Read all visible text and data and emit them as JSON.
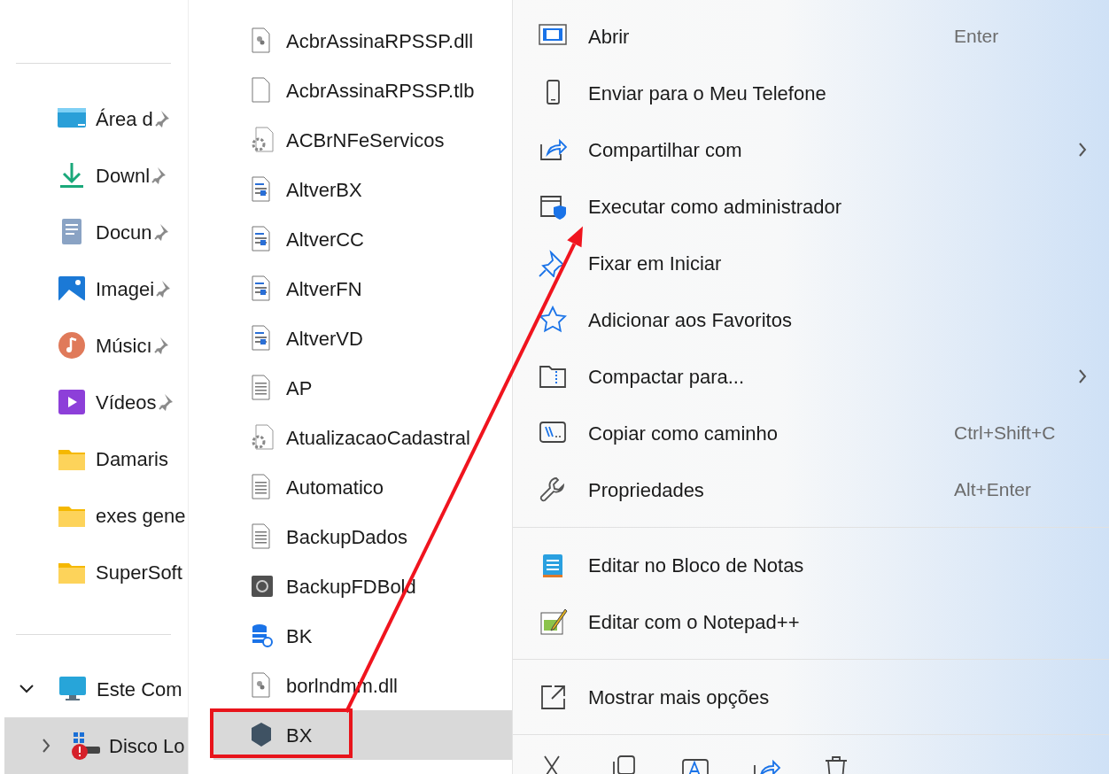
{
  "nav": {
    "quick_access": [
      {
        "label": "Área d",
        "kind": "desktop",
        "pinned": true,
        "selected": false
      },
      {
        "label": "Downl",
        "kind": "download",
        "pinned": true,
        "selected": false
      },
      {
        "label": "Docun",
        "kind": "document",
        "pinned": true,
        "selected": false
      },
      {
        "label": "Imagei",
        "kind": "image",
        "pinned": true,
        "selected": false
      },
      {
        "label": "Músicı",
        "kind": "music",
        "pinned": true,
        "selected": false
      },
      {
        "label": "Vídeos",
        "kind": "video",
        "pinned": true,
        "selected": false
      },
      {
        "label": "Damaris",
        "kind": "folder",
        "pinned": false,
        "selected": false
      },
      {
        "label": "exes gene",
        "kind": "folder",
        "pinned": false,
        "selected": false
      },
      {
        "label": "SuperSoft",
        "kind": "folder",
        "pinned": false,
        "selected": false
      }
    ],
    "tree": [
      {
        "label": "Este Com",
        "kind": "pc",
        "expanded": true,
        "selected": false,
        "children": [
          {
            "label": "Disco Lo",
            "kind": "drive",
            "expanded": false,
            "selected": true
          }
        ]
      }
    ]
  },
  "files": [
    {
      "name": "AcbrAssinaRPSSP.dll",
      "kind": "dll",
      "selected": false,
      "highlighted": false
    },
    {
      "name": "AcbrAssinaRPSSP.tlb",
      "kind": "blank",
      "selected": false,
      "highlighted": false
    },
    {
      "name": "ACBrNFeServicos",
      "kind": "gear",
      "selected": false,
      "highlighted": false
    },
    {
      "name": "AltverBX",
      "kind": "config",
      "selected": false,
      "highlighted": false
    },
    {
      "name": "AltverCC",
      "kind": "config",
      "selected": false,
      "highlighted": false
    },
    {
      "name": "AltverFN",
      "kind": "config",
      "selected": false,
      "highlighted": false
    },
    {
      "name": "AltverVD",
      "kind": "config",
      "selected": false,
      "highlighted": false
    },
    {
      "name": "AP",
      "kind": "text",
      "selected": false,
      "highlighted": false
    },
    {
      "name": "AtualizacaoCadastral",
      "kind": "gear",
      "selected": false,
      "highlighted": false
    },
    {
      "name": "Automatico",
      "kind": "text",
      "selected": false,
      "highlighted": false
    },
    {
      "name": "BackupDados",
      "kind": "text",
      "selected": false,
      "highlighted": false
    },
    {
      "name": "BackupFDBold",
      "kind": "dark",
      "selected": false,
      "highlighted": false
    },
    {
      "name": "BK",
      "kind": "database",
      "selected": false,
      "highlighted": false
    },
    {
      "name": "borlndmm.dll",
      "kind": "dll",
      "selected": false,
      "highlighted": false
    },
    {
      "name": "BX",
      "kind": "xml",
      "selected": true,
      "highlighted": true
    }
  ],
  "context_menu": {
    "groups": [
      {
        "items": [
          {
            "label": "Abrir",
            "kind": "open",
            "shortcut": "Enter",
            "submenu": false
          },
          {
            "label": "Enviar para o Meu Telefone",
            "kind": "phone",
            "submenu": false
          },
          {
            "label": "Compartilhar com",
            "kind": "share",
            "submenu": true
          },
          {
            "label": "Executar como administrador",
            "kind": "admin",
            "submenu": false,
            "arrow_target": true
          },
          {
            "label": "Fixar em Iniciar",
            "kind": "pin",
            "submenu": false
          },
          {
            "label": "Adicionar aos Favoritos",
            "kind": "star",
            "submenu": false
          },
          {
            "label": "Compactar para...",
            "kind": "zip",
            "submenu": true
          },
          {
            "label": "Copiar como caminho",
            "kind": "path",
            "shortcut": "Ctrl+Shift+C",
            "submenu": false
          },
          {
            "label": "Propriedades",
            "kind": "wrench",
            "shortcut": "Alt+Enter",
            "submenu": false
          }
        ]
      },
      {
        "items": [
          {
            "label": "Editar no Bloco de Notas",
            "kind": "notepad",
            "submenu": false
          },
          {
            "label": "Editar com o Notepad++",
            "kind": "notepadpp",
            "submenu": false
          }
        ]
      },
      {
        "items": [
          {
            "label": "Mostrar mais opções",
            "kind": "more",
            "submenu": false
          }
        ]
      }
    ],
    "toolbar": [
      {
        "kind": "cut"
      },
      {
        "kind": "copy"
      },
      {
        "kind": "rename"
      },
      {
        "kind": "share"
      },
      {
        "kind": "delete"
      }
    ]
  }
}
